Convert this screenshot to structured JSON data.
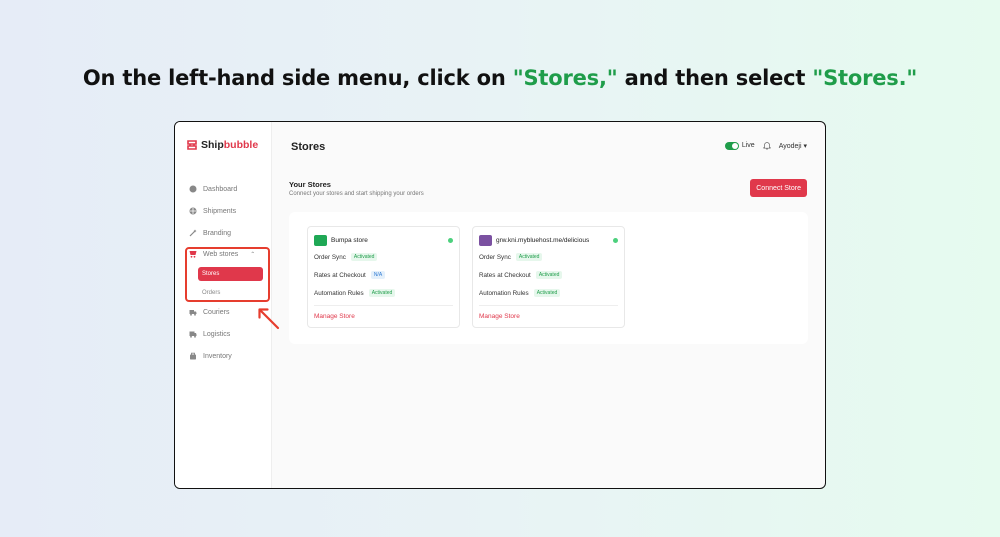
{
  "instruction": {
    "prefix": "On the left-hand side menu, click on ",
    "highlight1": "\"Stores,\"",
    "middle": " and then select ",
    "highlight2": "\"Stores.\""
  },
  "brand": {
    "part1": "Ship",
    "part2": "bubble"
  },
  "sidebar": {
    "items": [
      {
        "label": "Dashboard",
        "icon": "dashboard-icon"
      },
      {
        "label": "Shipments",
        "icon": "shipments-icon"
      },
      {
        "label": "Branding",
        "icon": "branding-icon"
      },
      {
        "label": "Web stores",
        "icon": "web-stores-icon"
      },
      {
        "label": "Couriers",
        "icon": "couriers-icon"
      },
      {
        "label": "Logistics",
        "icon": "logistics-icon"
      },
      {
        "label": "Inventory",
        "icon": "inventory-icon"
      }
    ],
    "subitems": [
      {
        "label": "Stores",
        "active": true
      },
      {
        "label": "Orders",
        "active": false
      }
    ]
  },
  "header": {
    "title": "Stores",
    "mode": "Live",
    "user": "Ayodeji"
  },
  "content": {
    "section_title": "Your Stores",
    "section_subtitle": "Connect your stores and start shipping your orders",
    "connect_button": "Connect Store",
    "stores": [
      {
        "name": "Bumpa store",
        "logo_color": "#1fa855",
        "order_sync_label": "Order Sync",
        "order_sync": "Activated",
        "rates_label": "Rates at Checkout",
        "rates": "N/A",
        "automation_label": "Automation Rules",
        "automation": "Activated",
        "manage": "Manage Store"
      },
      {
        "name": "grw.kni.mybluehost.me/delicious",
        "logo_color": "#7b51a1",
        "order_sync_label": "Order Sync",
        "order_sync": "Activated",
        "rates_label": "Rates at Checkout",
        "rates": "Activated",
        "automation_label": "Automation Rules",
        "automation": "Activated",
        "manage": "Manage Store"
      }
    ]
  },
  "colors": {
    "accent": "#e0384b",
    "highlight_text": "#1f9d4a",
    "annotation": "#e63d2e"
  }
}
